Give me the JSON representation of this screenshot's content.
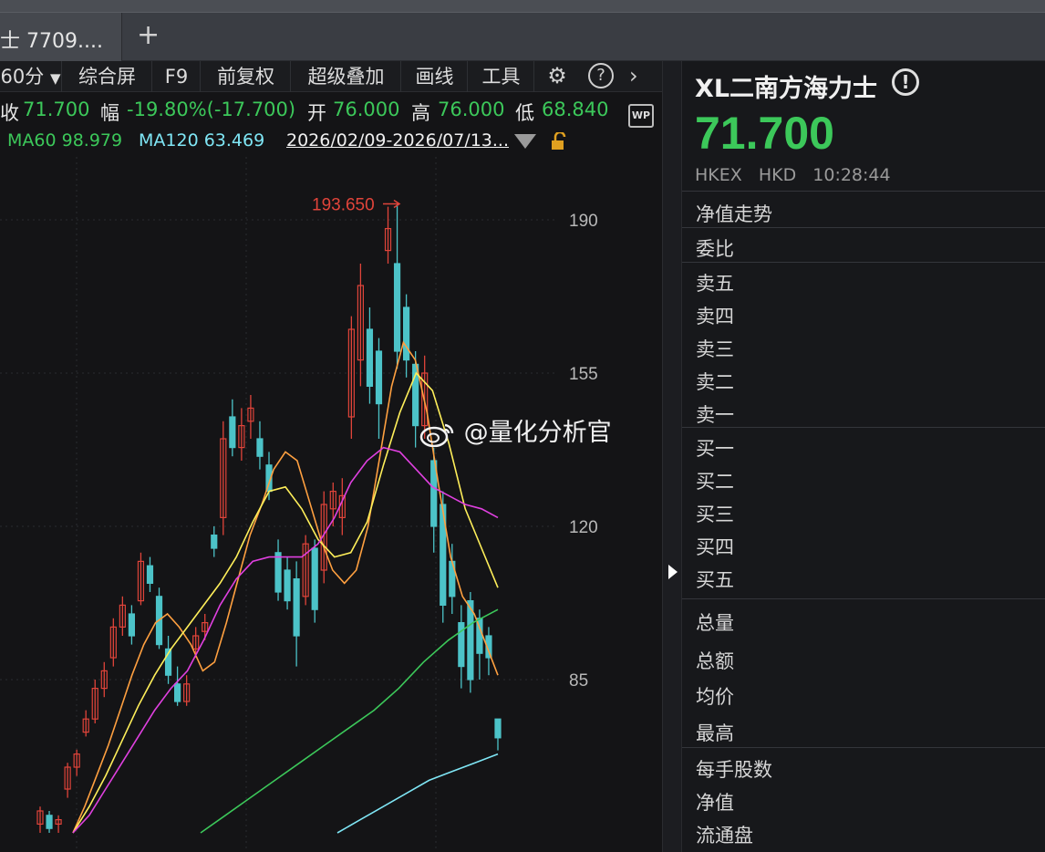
{
  "tab": {
    "title": "士 7709....",
    "add_label": "+"
  },
  "toolbar": {
    "period": "60分",
    "items": [
      "综合屏",
      "F9",
      "前复权",
      "超级叠加",
      "画线",
      "工具"
    ],
    "settings_icon": "gear-icon",
    "help_icon": "question-icon",
    "more_icon": "chevron-right-icon"
  },
  "quote": {
    "close_label": "收",
    "close": "71.700",
    "change_label": "幅",
    "change": "-19.80%(-17.700)",
    "open_label": "开",
    "open": "76.000",
    "high_label": "高",
    "high": "76.000",
    "low_label": "低",
    "low": "68.840",
    "wp_badge": "WP"
  },
  "ma": {
    "ma60": "MA60 98.979",
    "ma120": "MA120 63.469",
    "range": "2026/02/09-2026/07/13...",
    "colors": {
      "ma60": "#3cc85a",
      "ma120": "#7fe6f5"
    }
  },
  "watermark": "@量化分析官",
  "chart_data": {
    "type": "line",
    "title": "",
    "y_ticks": [
      190,
      155,
      120,
      85
    ],
    "peak_label": "193.650",
    "ylim": [
      50,
      200
    ],
    "candles": [
      {
        "o": 52,
        "c": 55,
        "h": 56,
        "l": 50
      },
      {
        "o": 54,
        "c": 51,
        "h": 55,
        "l": 50
      },
      {
        "o": 52,
        "c": 53,
        "h": 54,
        "l": 50
      },
      {
        "o": 60,
        "c": 65,
        "h": 66,
        "l": 58
      },
      {
        "o": 65,
        "c": 68,
        "h": 69,
        "l": 63
      },
      {
        "o": 73,
        "c": 76,
        "h": 78,
        "l": 72
      },
      {
        "o": 76,
        "c": 83,
        "h": 85,
        "l": 75
      },
      {
        "o": 83,
        "c": 87,
        "h": 89,
        "l": 81
      },
      {
        "o": 90,
        "c": 97,
        "h": 99,
        "l": 88
      },
      {
        "o": 97,
        "c": 102,
        "h": 104,
        "l": 95
      },
      {
        "o": 100,
        "c": 95,
        "h": 102,
        "l": 93
      },
      {
        "o": 103,
        "c": 112,
        "h": 114,
        "l": 102
      },
      {
        "o": 111,
        "c": 107,
        "h": 113,
        "l": 105
      },
      {
        "o": 104,
        "c": 93,
        "h": 106,
        "l": 92
      },
      {
        "o": 92,
        "c": 86,
        "h": 95,
        "l": 84
      },
      {
        "o": 84,
        "c": 80,
        "h": 88,
        "l": 79
      },
      {
        "o": 80,
        "c": 84,
        "h": 86,
        "l": 79
      },
      {
        "o": 92,
        "c": 95,
        "h": 97,
        "l": 90
      },
      {
        "o": 96,
        "c": 98,
        "h": 100,
        "l": 94
      },
      {
        "o": 118,
        "c": 115,
        "h": 120,
        "l": 113
      },
      {
        "o": 122,
        "c": 140,
        "h": 144,
        "l": 118
      },
      {
        "o": 145,
        "c": 138,
        "h": 149,
        "l": 136
      },
      {
        "o": 138,
        "c": 143,
        "h": 147,
        "l": 135
      },
      {
        "o": 144,
        "c": 147,
        "h": 150,
        "l": 140
      },
      {
        "o": 140,
        "c": 136,
        "h": 144,
        "l": 133
      },
      {
        "o": 134,
        "c": 128,
        "h": 137,
        "l": 126
      },
      {
        "o": 114,
        "c": 105,
        "h": 117,
        "l": 103
      },
      {
        "o": 110,
        "c": 103,
        "h": 113,
        "l": 101
      },
      {
        "o": 108,
        "c": 95,
        "h": 112,
        "l": 88
      },
      {
        "o": 104,
        "c": 116,
        "h": 118,
        "l": 102
      },
      {
        "o": 115,
        "c": 101,
        "h": 117,
        "l": 98
      },
      {
        "o": 110,
        "c": 125,
        "h": 128,
        "l": 107
      },
      {
        "o": 124,
        "c": 128,
        "h": 130,
        "l": 120
      },
      {
        "o": 122,
        "c": 127,
        "h": 131,
        "l": 118
      },
      {
        "o": 145,
        "c": 165,
        "h": 168,
        "l": 140
      },
      {
        "o": 158,
        "c": 175,
        "h": 180,
        "l": 152
      },
      {
        "o": 165,
        "c": 152,
        "h": 170,
        "l": 148
      },
      {
        "o": 160,
        "c": 148,
        "h": 163,
        "l": 140
      },
      {
        "o": 183,
        "c": 188,
        "h": 193,
        "l": 180
      },
      {
        "o": 180,
        "c": 160,
        "h": 193.65,
        "l": 156
      },
      {
        "o": 170,
        "c": 158,
        "h": 173,
        "l": 154
      },
      {
        "o": 157,
        "c": 143,
        "h": 160,
        "l": 138
      },
      {
        "o": 143,
        "c": 155,
        "h": 159,
        "l": 140
      },
      {
        "o": 135,
        "c": 120,
        "h": 138,
        "l": 114
      },
      {
        "o": 125,
        "c": 102,
        "h": 128,
        "l": 98
      },
      {
        "o": 112,
        "c": 104,
        "h": 116,
        "l": 100
      },
      {
        "o": 98,
        "c": 88,
        "h": 102,
        "l": 83
      },
      {
        "o": 103,
        "c": 85,
        "h": 105,
        "l": 82
      },
      {
        "o": 99,
        "c": 91,
        "h": 101,
        "l": 85
      },
      {
        "o": 95,
        "c": 90,
        "h": 97,
        "l": 86
      },
      {
        "o": 76,
        "c": 71.7,
        "h": 76,
        "l": 68.84
      }
    ],
    "series": [
      {
        "color": "#ffa040",
        "values": [
          50,
          56,
          63,
          70,
          78,
          86,
          93,
          98,
          100,
          97,
          93,
          87,
          89,
          98,
          108,
          118,
          125,
          133,
          137,
          135,
          126,
          117,
          110,
          107,
          110,
          120,
          136,
          152,
          162,
          158,
          146,
          129,
          113,
          104,
          100,
          93,
          86
        ]
      },
      {
        "color": "#ffef5a",
        "values": [
          50,
          56,
          63,
          71,
          79,
          86,
          92,
          97,
          102,
          107,
          113,
          121,
          128,
          129,
          124,
          117,
          113,
          114,
          121,
          134,
          146,
          155,
          151,
          139,
          124,
          115,
          106
        ]
      },
      {
        "color": "#e040e0",
        "values": [
          50,
          54,
          60,
          66,
          72,
          78,
          83,
          87,
          94,
          102,
          108,
          112,
          113,
          113,
          113,
          116,
          122,
          130,
          135,
          138,
          137,
          133,
          129,
          127,
          125,
          124,
          122
        ]
      },
      {
        "color": "#3cc85a",
        "values": [
          50,
          54,
          58,
          62,
          66,
          70,
          74,
          78,
          83,
          89,
          94,
          98,
          101
        ]
      },
      {
        "color": "#7fe6f5",
        "values": [
          50,
          53,
          56,
          59,
          62,
          64,
          66,
          68
        ]
      }
    ]
  },
  "right": {
    "name": "XL二南方海力士",
    "price": "71.700",
    "exchange": "HKEX",
    "currency": "HKD",
    "time": "10:28:44",
    "nav_trend": "净值走势",
    "ratio": "委比",
    "asks": [
      "卖五",
      "卖四",
      "卖三",
      "卖二",
      "卖一"
    ],
    "bids": [
      "买一",
      "买二",
      "买三",
      "买四",
      "买五"
    ],
    "stats1": [
      "总量",
      "总额",
      "均价",
      "最高"
    ],
    "stats2": [
      "每手股数",
      "净值",
      "流通盘"
    ]
  }
}
